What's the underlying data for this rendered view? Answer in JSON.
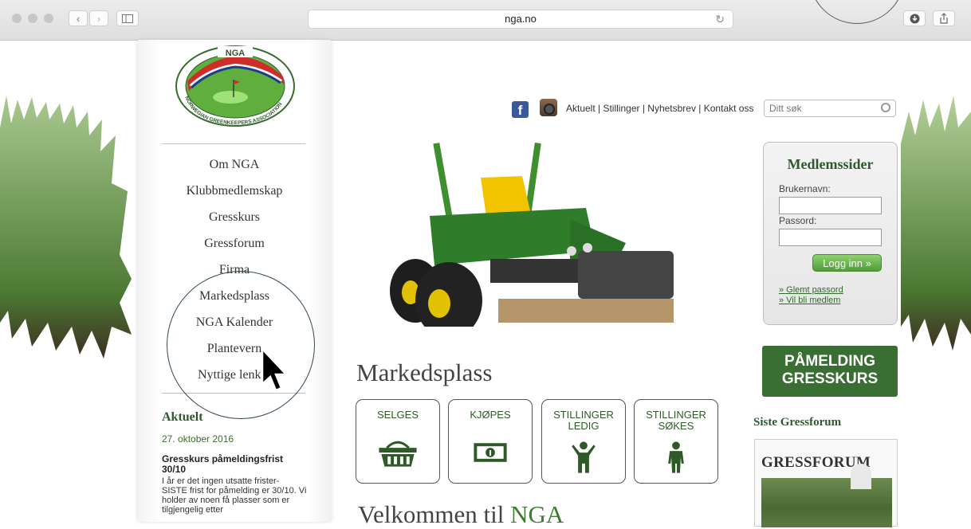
{
  "browser": {
    "url": "nga.no"
  },
  "logo": {
    "text_top": "NGA",
    "text_ring": "NORWEGIAN GREENKEEPERS ASSOCIATION"
  },
  "nav": {
    "items": [
      "Om NGA",
      "Klubbmedlemskap",
      "Gresskurs",
      "Gressforum",
      "Firma",
      "Markedsplass",
      "NGA Kalender",
      "Plantevern",
      "Nyttige lenker"
    ]
  },
  "aktuelt": {
    "heading": "Aktuelt",
    "date": "27. oktober 2016",
    "title": "Gresskurs påmeldingsfrist 30/10",
    "body": "I år er det ingen utsatte frister- SISTE frist for påmelding er 30/10. Vi holder av noen få plasser som er tilgjengelig etter"
  },
  "header": {
    "links": "Aktuelt | Stillinger | Nyhetsbrev | Kontakt oss",
    "search_placeholder": "Ditt søk"
  },
  "market": {
    "title": "Markedsplass",
    "tiles": [
      {
        "label": "SELGES",
        "icon": "basket-icon"
      },
      {
        "label": "KJØPES",
        "icon": "banknote-icon"
      },
      {
        "label": "STILLINGER LEDIG",
        "icon": "person-arms-up-icon"
      },
      {
        "label": "STILLINGER SØKES",
        "icon": "person-icon"
      }
    ]
  },
  "welcome": {
    "prefix": "Velkommen til ",
    "brand": "NGA"
  },
  "member": {
    "title": "Medlemssider",
    "username_label": "Brukernavn:",
    "password_label": "Passord:",
    "login_label": "Logg inn »",
    "forgot_label": "» Glemt passord",
    "join_label": "» Vil bli medlem"
  },
  "signup": {
    "line1": "PÅMELDING",
    "line2": "GRESSKURS"
  },
  "forum": {
    "heading": "Siste Gressforum",
    "magazine_title": "GRESSFORUM"
  },
  "colors": {
    "brand_green": "#3a6f33",
    "text_green": "#2d5a2d"
  }
}
